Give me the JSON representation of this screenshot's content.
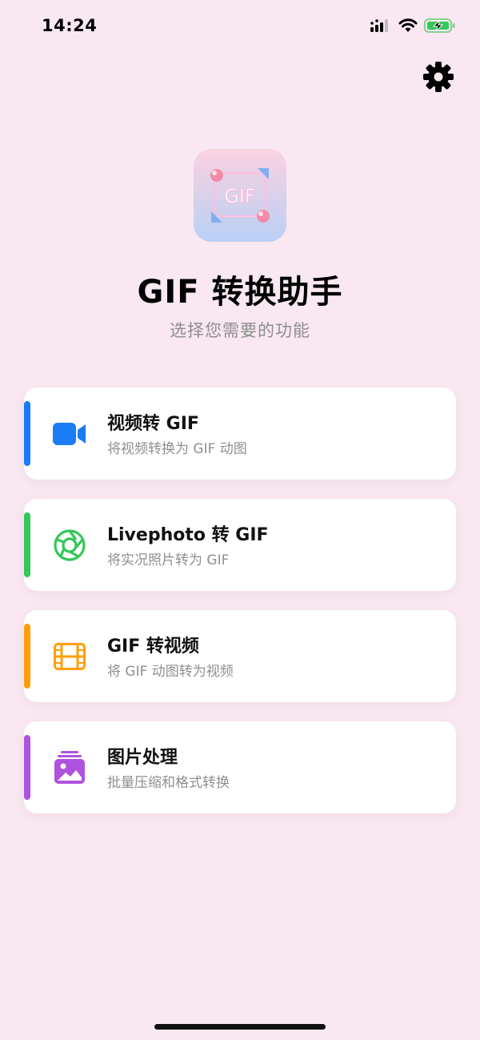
{
  "status_bar": {
    "time": "14:24"
  },
  "header": {
    "settings_icon": "gear-icon",
    "app_icon_text": "GIF",
    "title": "GIF 转换助手",
    "subtitle": "选择您需要的功能"
  },
  "features": [
    {
      "title": "视频转 GIF",
      "description": "将视频转换为 GIF 动图",
      "icon": "video-camera-icon",
      "accent": "#1a7cf5"
    },
    {
      "title": "Livephoto 转 GIF",
      "description": "将实况照片转为 GIF",
      "icon": "live-photo-icon",
      "accent": "#34c759"
    },
    {
      "title": "GIF 转视频",
      "description": "将 GIF 动图转为视频",
      "icon": "film-icon",
      "accent": "#ff9f0a"
    },
    {
      "title": "图片处理",
      "description": "批量压缩和格式转换",
      "icon": "photo-stack-icon",
      "accent": "#af52de"
    }
  ]
}
